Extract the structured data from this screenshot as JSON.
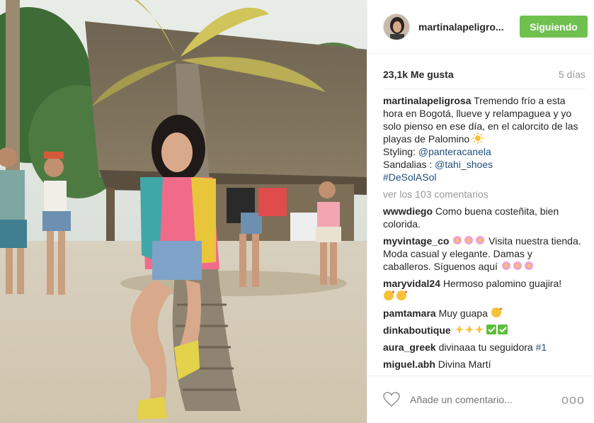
{
  "header": {
    "username": "martinalapeligro...",
    "follow_label": "Siguiendo",
    "colors": {
      "follow_bg": "#70c050"
    }
  },
  "stats": {
    "likes": "23,1k Me gusta",
    "time": "5 días"
  },
  "caption": {
    "user": "martinalapeligrosa",
    "text1": "Tremendo frío a esta hora en Bogotá, llueve y relampaguea y yo solo pienso en ese día, en el calorcito de las playas de Palomino",
    "styling_label": "Styling: ",
    "styling_link": "@panteracanela",
    "sandalias_label": "Sandalias : ",
    "sandalias_link": "@tahi_shoes",
    "hashtag": "#DeSolASol"
  },
  "view_all": "ver los 103 comentarios",
  "comments": [
    {
      "user": "wwwdiego",
      "text": "Como buena costeñita, bien colorida."
    },
    {
      "user": "myvintage_co",
      "text_a": "Visita nuestra tienda. Moda casual y elegante. Damas y caballeros. Síguenos aquí"
    },
    {
      "user": "maryvidal24",
      "text": "Hermoso palomino guajira!"
    },
    {
      "user": "pamtamara",
      "text": "Muy guapa"
    },
    {
      "user": "dinkaboutique",
      "text": ""
    },
    {
      "user": "aura_greek",
      "text": "divinaaa tu seguidora ",
      "link": "#1"
    },
    {
      "user": "miguel.abh",
      "text": "Divina Martí"
    }
  ],
  "footer": {
    "placeholder": "Añade un comentario...",
    "more": "ooo"
  }
}
